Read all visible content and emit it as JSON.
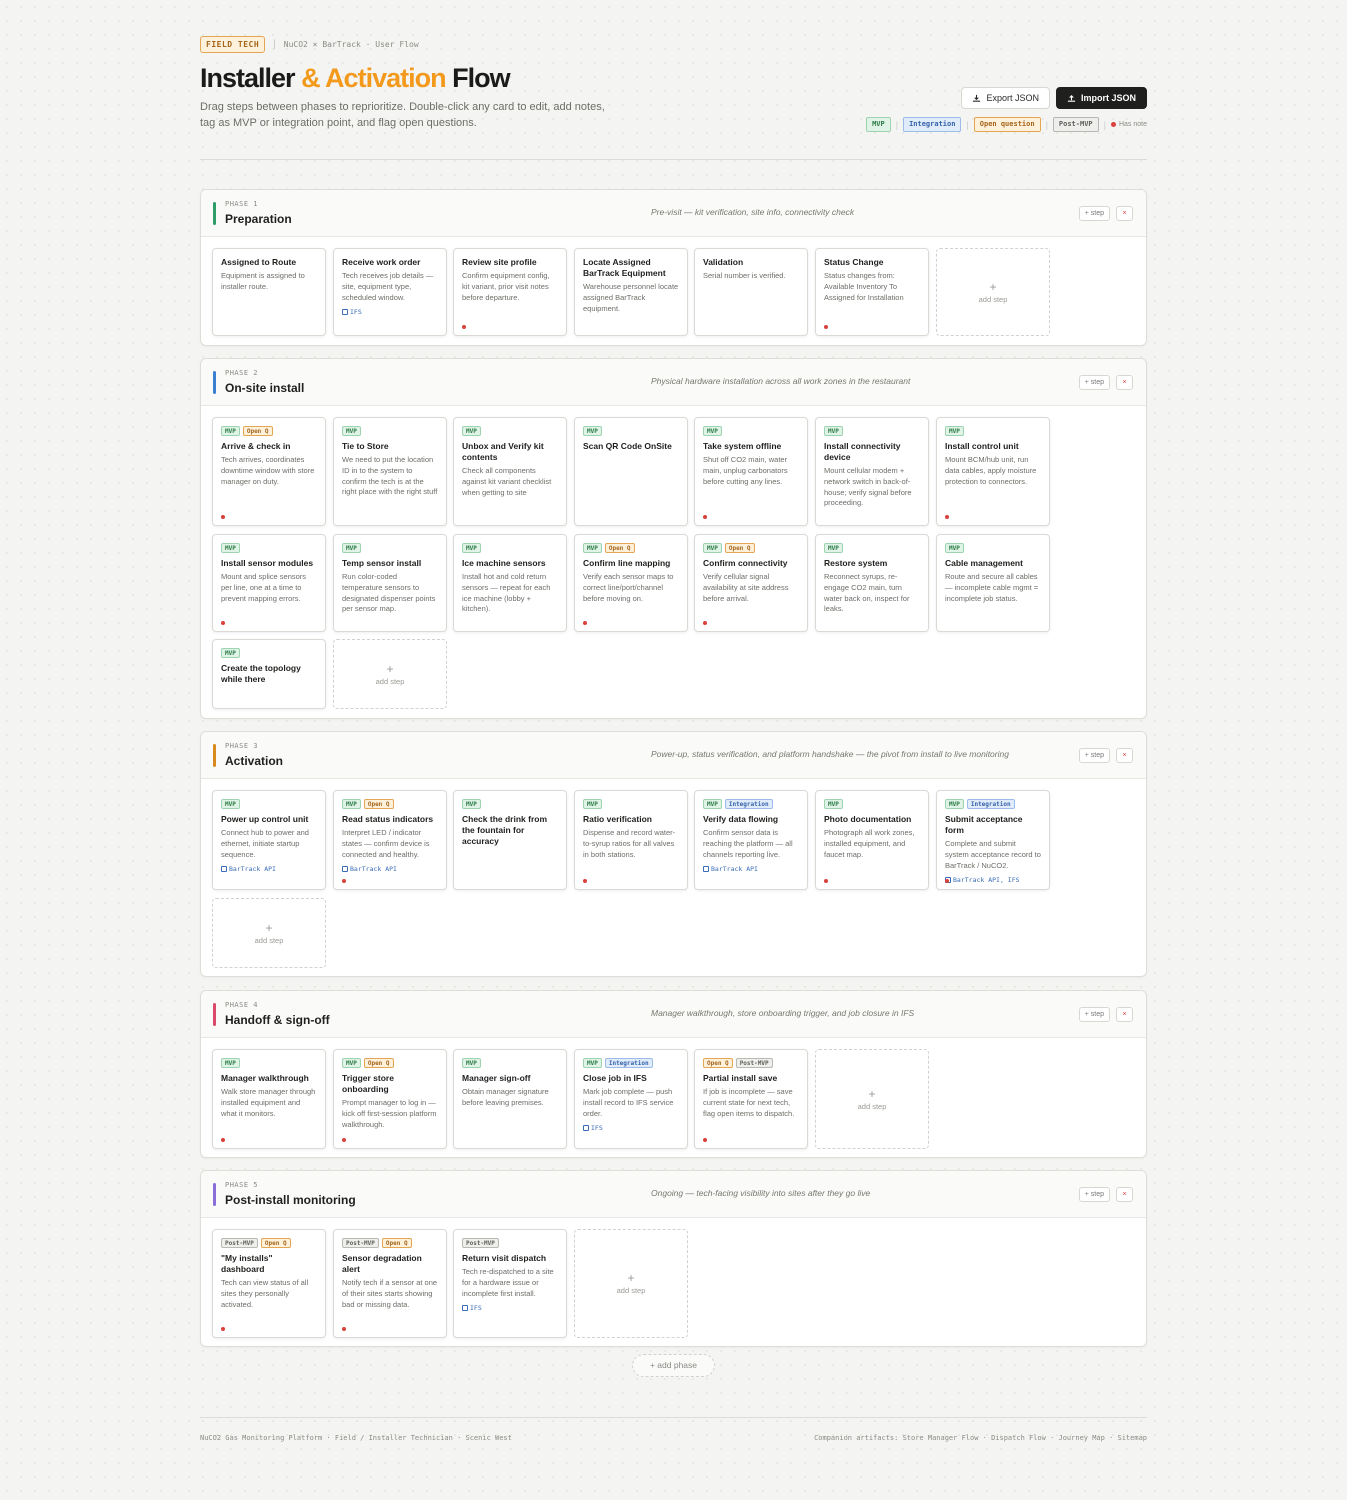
{
  "header": {
    "role_badge": "FIELD TECH",
    "breadcrumb": "NuCO2 × BarTrack · User Flow",
    "title_a": "Installer",
    "title_b": "& Activation",
    "title_c": "Flow",
    "subtitle": "Drag steps between phases to reprioritize. Double-click any card to edit, add notes, tag as MVP or integration point, and flag open questions.",
    "export_label": "Export JSON",
    "import_label": "Import JSON",
    "legend": {
      "mvp": "MVP",
      "integration": "Integration",
      "open": "Open question",
      "post": "Post-MVP",
      "note": "Has note"
    },
    "accent_color": "#f39a1d"
  },
  "tags": {
    "mvp": "MVP",
    "int": "Integration",
    "open": "Open Q",
    "post": "Post-MVP"
  },
  "phases": [
    {
      "num": "PHASE 1",
      "name": "Preparation",
      "desc": "Pre-visit — kit verification, site info, connectivity check",
      "color": "#2e9d6a",
      "add_step": "+ step",
      "remove": "×",
      "cards": [
        {
          "title": "Assigned to Route",
          "desc": "Equipment is assigned to installer route."
        },
        {
          "title": "Receive work order",
          "desc": "Tech receives job details — site, equipment type, scheduled window.",
          "link": "IFS"
        },
        {
          "title": "Review site profile",
          "desc": "Confirm equipment config, kit variant, prior visit notes before departure."
        },
        {
          "title": "Locate Assigned BarTrack Equipment",
          "desc": "Warehouse personnel locate assigned BarTrack equipment."
        },
        {
          "title": "Validation",
          "desc": "Serial number is verified."
        },
        {
          "title": "Status Change",
          "desc": "Status changes from: Available Inventory To Assigned for Installation"
        }
      ],
      "add_label": "add step"
    },
    {
      "num": "PHASE 2",
      "name": "On-site install",
      "desc": "Physical hardware installation across all work zones in the restaurant",
      "color": "#3b7fd1",
      "add_step": "+ step",
      "remove": "×",
      "cards": [
        {
          "title": "Arrive & check in",
          "desc": "Tech arrives, coordinates downtime window with store manager on duty."
        },
        {
          "title": "Tie to Store",
          "desc": "We need to put the location ID in to the system to confirm the tech is at the right place with the right stuff"
        },
        {
          "title": "Unbox and Verify kit contents",
          "desc": "Check all components against kit variant checklist when getting to site"
        },
        {
          "title": "Scan QR Code OnSite",
          "desc": ""
        },
        {
          "title": "Take system offline",
          "desc": "Shut off CO2 main, water main, unplug carbonators before cutting any lines."
        },
        {
          "title": "Install connectivity device",
          "desc": "Mount cellular modem + network switch in back-of-house; verify signal before proceeding."
        },
        {
          "title": "Install control unit",
          "desc": "Mount BCM/hub unit, run data cables, apply moisture protection to connectors."
        },
        {
          "title": "Install sensor modules",
          "desc": "Mount and splice sensors per line, one at a time to prevent mapping errors."
        },
        {
          "title": "Temp sensor install",
          "desc": "Run color-coded temperature sensors to designated dispenser points per sensor map."
        },
        {
          "title": "Ice machine sensors",
          "desc": "Install hot and cold return sensors — repeat for each ice machine (lobby + kitchen)."
        },
        {
          "title": "Confirm line mapping",
          "desc": "Verify each sensor maps to correct line/port/channel before moving on."
        },
        {
          "title": "Confirm connectivity",
          "desc": "Verify cellular signal availability at site address before arrival."
        },
        {
          "title": "Restore system",
          "desc": "Reconnect syrups, re-engage CO2 main, turn water back on, inspect for leaks."
        },
        {
          "title": "Cable management",
          "desc": "Route and secure all cables — incomplete cable mgmt = incomplete job status."
        },
        {
          "title": "Create the topology while there",
          "desc": ""
        }
      ],
      "add_label": "add step"
    },
    {
      "num": "PHASE 3",
      "name": "Activation",
      "desc": "Power-up, status verification, and platform handshake — the pivot from install to live monitoring",
      "color": "#d98a1f",
      "add_step": "+ step",
      "remove": "×",
      "cards": [
        {
          "title": "Power up control unit",
          "desc": "Connect hub to power and ethernet, initiate startup sequence.",
          "link": "BarTrack API"
        },
        {
          "title": "Read status indicators",
          "desc": "Interpret LED / indicator states — confirm device is connected and healthy.",
          "link": "BarTrack API"
        },
        {
          "title": "Check the drink from the fountain for accuracy",
          "desc": ""
        },
        {
          "title": "Ratio verification",
          "desc": "Dispense and record water-to-syrup ratios for all valves in both stations."
        },
        {
          "title": "Verify data flowing",
          "desc": "Confirm sensor data is reaching the platform — all channels reporting live.",
          "link": "BarTrack API"
        },
        {
          "title": "Photo documentation",
          "desc": "Photograph all work zones, installed equipment, and faucet map."
        },
        {
          "title": "Submit acceptance form",
          "desc": "Complete and submit system acceptance record to BarTrack / NuCO2.",
          "link": "BarTrack API, IFS"
        }
      ],
      "add_label": "add step"
    },
    {
      "num": "PHASE 4",
      "name": "Handoff & sign-off",
      "desc": "Manager walkthrough, store onboarding trigger, and job closure in IFS",
      "color": "#d94a6a",
      "add_step": "+ step",
      "remove": "×",
      "cards": [
        {
          "title": "Manager walkthrough",
          "desc": "Walk store manager through installed equipment and what it monitors."
        },
        {
          "title": "Trigger store onboarding",
          "desc": "Prompt manager to log in — kick off first-session platform walkthrough."
        },
        {
          "title": "Manager sign-off",
          "desc": "Obtain manager signature before leaving premises."
        },
        {
          "title": "Close job in IFS",
          "desc": "Mark job complete — push install record to IFS service order.",
          "link": "IFS"
        },
        {
          "title": "Partial install save",
          "desc": "If job is incomplete — save current state for next tech, flag open items to dispatch."
        }
      ],
      "add_label": "add step"
    },
    {
      "num": "PHASE 5",
      "name": "Post-install monitoring",
      "desc": "Ongoing — tech-facing visibility into sites after they go live",
      "color": "#8a6fd9",
      "add_step": "+ step",
      "remove": "×",
      "cards": [
        {
          "title": "\"My installs\" dashboard",
          "desc": "Tech can view status of all sites they personally activated."
        },
        {
          "title": "Sensor degradation alert",
          "desc": "Notify tech if a sensor at one of their sites starts showing bad or missing data."
        },
        {
          "title": "Return visit dispatch",
          "desc": "Tech re-dispatched to a site for a hardware issue or incomplete first install.",
          "link": "IFS"
        }
      ],
      "add_label": "add step"
    }
  ],
  "add_phase": "+ add phase",
  "footer": {
    "left": "NuCO2 Gas Monitoring Platform · Field / Installer Technician · Scenic West",
    "right": "Companion artifacts: Store Manager Flow · Dispatch Flow · Journey Map · Sitemap"
  }
}
